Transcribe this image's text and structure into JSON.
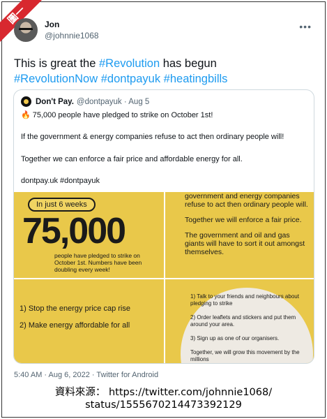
{
  "badge": "圖一",
  "author": {
    "name": "Jon",
    "handle": "@johnnie1068"
  },
  "more_icon": "more-horizontal-icon",
  "tweet": {
    "text_prefix": "This is great the ",
    "tags": [
      "#Revolution",
      "#RevolutionNow",
      "#dontpayuk",
      "#heatingbills"
    ],
    "text_mid": " has begun"
  },
  "quoted": {
    "name": "Don't Pay.",
    "handle": "@dontpayuk",
    "date": "· Aug 5",
    "line1": "75,000 people have pledged to strike on October 1st!",
    "line2": "If the government & energy companies refuse to act then ordinary people will!",
    "line3": "Together we can enforce a fair price and affordable energy for all.",
    "line4": "dontpay.uk #dontpayuk",
    "panel1": {
      "pill": "In just 6 weeks",
      "big": "75,000",
      "small": "people have pledged to strike on October 1st. Numbers have been doubling every week!"
    },
    "panel2": {
      "p1": "government and energy companies refuse to act then ordinary people will.",
      "p2": "Together we will enforce a fair price.",
      "p3": "The government and oil and gas giants will have to sort it out amongst themselves."
    },
    "panel3": {
      "item1": "1) Stop the energy price cap rise",
      "item2": "2) Make energy affordable for all"
    },
    "panel4": {
      "item1": "1) Talk to your friends and neighbours about pledging to strike",
      "item2": "2) Order leaflets and stickers and put them around your area.",
      "item3": "3) Sign up as one of our organisers.",
      "item4": "Together, we will grow this movement by the millions"
    }
  },
  "footer": "5:40 AM · Aug 6, 2022 · Twitter for Android",
  "credit": {
    "line1": "資料來源： https://twitter.com/johnnie1068/",
    "line2": "status/1555670214473392129"
  }
}
